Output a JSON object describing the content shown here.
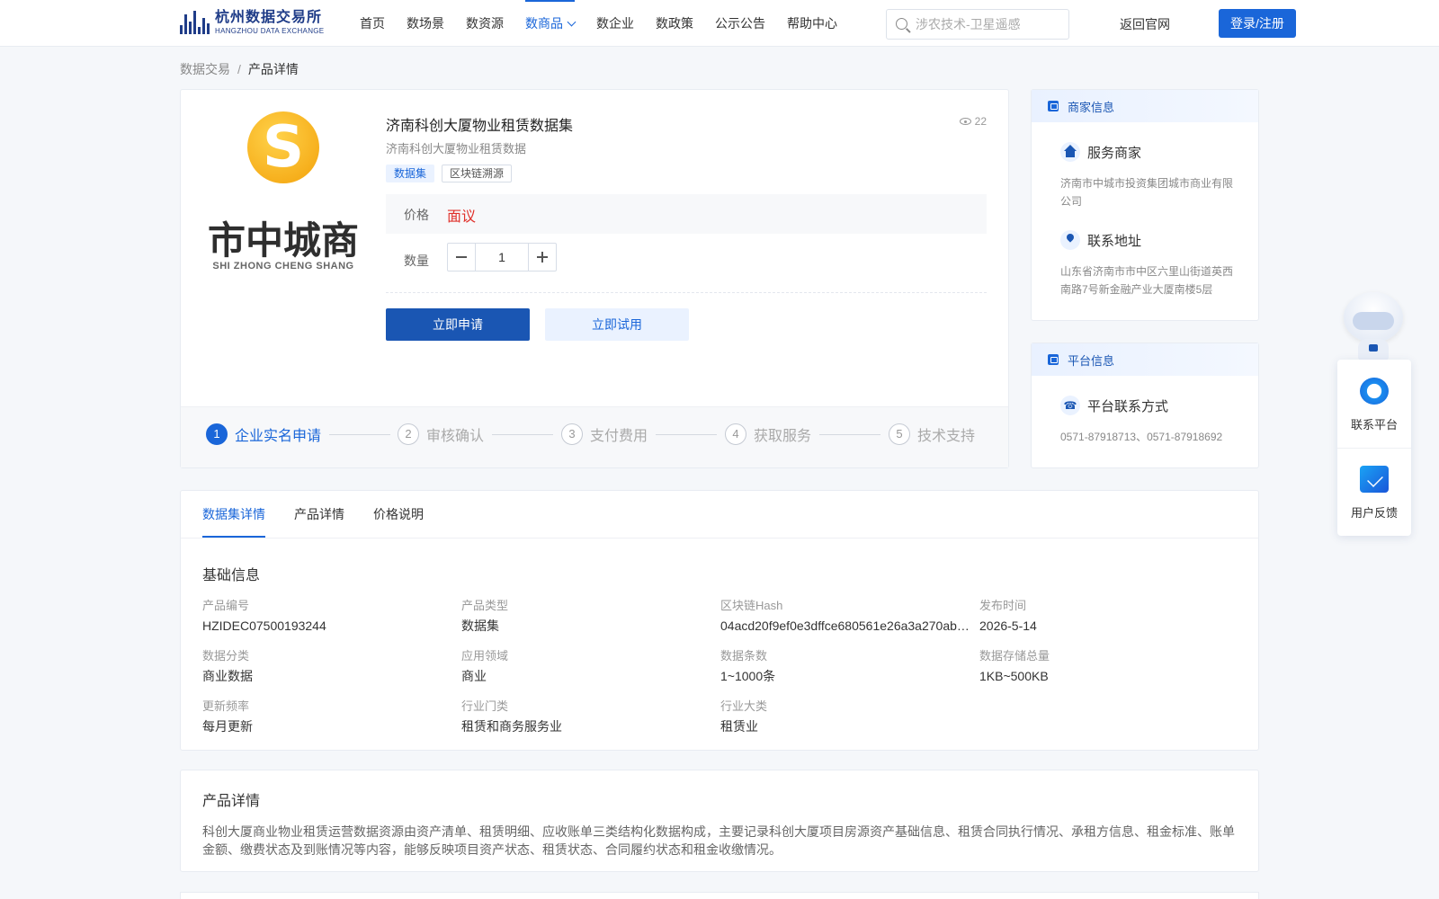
{
  "header": {
    "logo_cn": "杭州数据交易所",
    "logo_en": "HANGZHOU DATA EXCHANGE",
    "nav": [
      "首页",
      "数场景",
      "数资源",
      "数商品",
      "数企业",
      "数政策",
      "公示公告",
      "帮助中心"
    ],
    "active_nav": "数商品",
    "search_placeholder": "涉农技术-卫星遥感",
    "back_link": "返回官网",
    "login": "登录/注册"
  },
  "breadcrumb": {
    "root": "数据交易",
    "sep": "/",
    "current": "产品详情"
  },
  "product": {
    "logo_cn": "市中城商",
    "logo_en": "SHI ZHONG CHENG SHANG",
    "title": "济南科创大厦物业租赁数据集",
    "subtitle": "济南科创大厦物业租赁数据",
    "views": "22",
    "tags": [
      "数据集",
      "区块链溯源"
    ],
    "price_label": "价格",
    "price_value": "面议",
    "qty_label": "数量",
    "qty_value": "1",
    "apply": "立即申请",
    "trial": "立即试用"
  },
  "steps": [
    {
      "num": "1",
      "label": "企业实名申请"
    },
    {
      "num": "2",
      "label": "审核确认"
    },
    {
      "num": "3",
      "label": "支付费用"
    },
    {
      "num": "4",
      "label": "获取服务"
    },
    {
      "num": "5",
      "label": "技术支持"
    }
  ],
  "merchant": {
    "head": "商家信息",
    "service_title": "服务商家",
    "service_text": "济南市中城市投资集团城市商业有限公司",
    "address_title": "联系地址",
    "address_text": "山东省济南市市中区六里山街道英西南路7号新金融产业大厦南楼5层"
  },
  "platform": {
    "head": "平台信息",
    "contact_title": "平台联系方式",
    "contact_text": "0571-87918713、0571-87918692"
  },
  "tabs": [
    "数据集详情",
    "产品详情",
    "价格说明"
  ],
  "basic": {
    "title": "基础信息",
    "fields": [
      {
        "k": "产品编号",
        "v": "HZIDEC07500193244"
      },
      {
        "k": "产品类型",
        "v": "数据集"
      },
      {
        "k": "区块链Hash",
        "v": "04acd20f9ef0e3dffce680561e26a3a270ab…"
      },
      {
        "k": "发布时间",
        "v": "2026-5-14"
      },
      {
        "k": "数据分类",
        "v": "商业数据"
      },
      {
        "k": "应用领域",
        "v": "商业"
      },
      {
        "k": "数据条数",
        "v": "1~1000条"
      },
      {
        "k": "数据存储总量",
        "v": "1KB~500KB"
      },
      {
        "k": "更新频率",
        "v": "每月更新"
      },
      {
        "k": "行业门类",
        "v": "租赁和商务服务业"
      },
      {
        "k": "行业大类",
        "v": "租赁业"
      }
    ]
  },
  "detail": {
    "title": "产品详情",
    "text": "科创大厦商业物业租赁运营数据资源由资产清单、租赁明细、应收账单三类结构化数据构成，主要记录科创大厦项目房源资产基础信息、租赁合同执行情况、承租方信息、租金标准、账单金额、缴费状态及到账情况等内容，能够反映项目资产状态、租赁状态、合同履约状态和租金收缴情况。"
  },
  "float": {
    "contact": "联系平台",
    "feedback": "用户反馈"
  }
}
